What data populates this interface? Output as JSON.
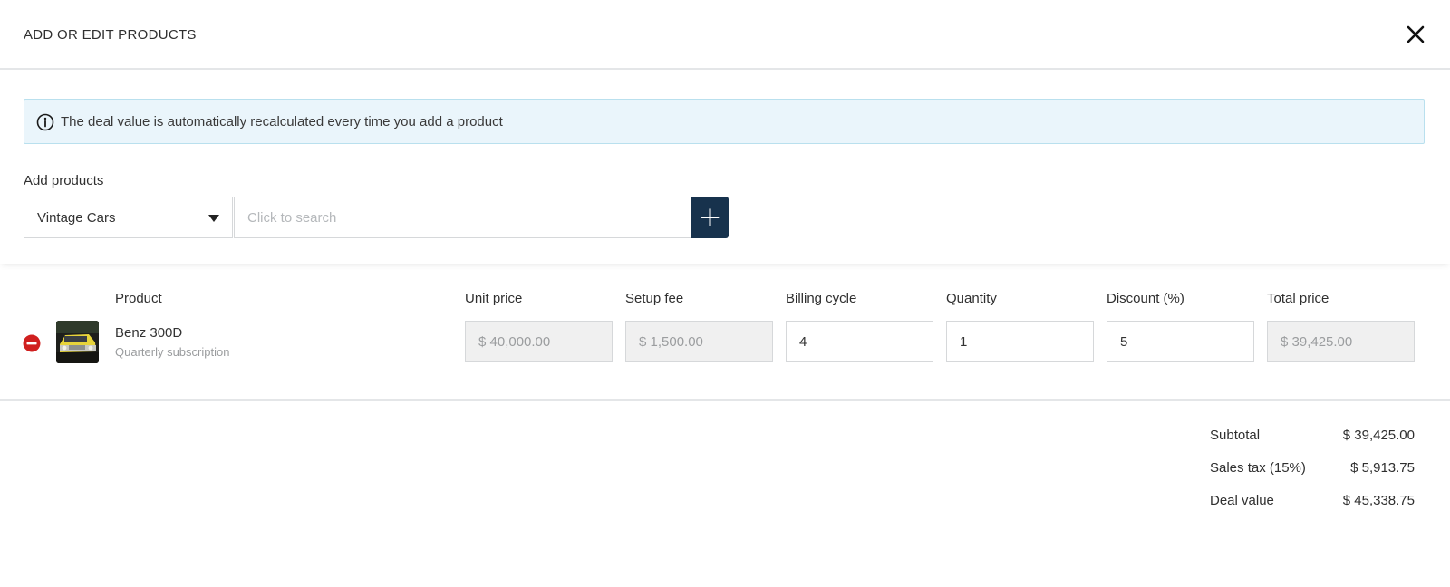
{
  "header": {
    "title": "ADD OR EDIT PRODUCTS",
    "close_icon": "close-icon"
  },
  "info": {
    "icon": "info-icon",
    "text": "The deal value is automatically recalculated every time you add a product"
  },
  "add_products": {
    "label": "Add products",
    "category": {
      "selected": "Vintage Cars"
    },
    "search": {
      "placeholder": "Click to search",
      "value": ""
    },
    "add_icon": "plus-icon"
  },
  "columns": {
    "product": "Product",
    "unit_price": "Unit price",
    "setup_fee": "Setup fee",
    "billing_cycle": "Billing cycle",
    "quantity": "Quantity",
    "discount": "Discount (%)",
    "total_price": "Total price"
  },
  "products": [
    {
      "name": "Benz 300D",
      "subtitle": "Quarterly subscription",
      "unit_price": "$ 40,000.00",
      "setup_fee": "$ 1,500.00",
      "billing_cycle": "4",
      "quantity": "1",
      "discount": "5",
      "total_price": "$ 39,425.00"
    }
  ],
  "totals": {
    "subtotal_label": "Subtotal",
    "subtotal_value": "$ 39,425.00",
    "tax_label": "Sales tax (15%)",
    "tax_value": "$ 5,913.75",
    "deal_label": "Deal value",
    "deal_value": "$ 45,338.75"
  },
  "colors": {
    "primary_button": "#17324d",
    "banner_bg": "#eaf5fb",
    "remove_icon": "#d0201f"
  }
}
